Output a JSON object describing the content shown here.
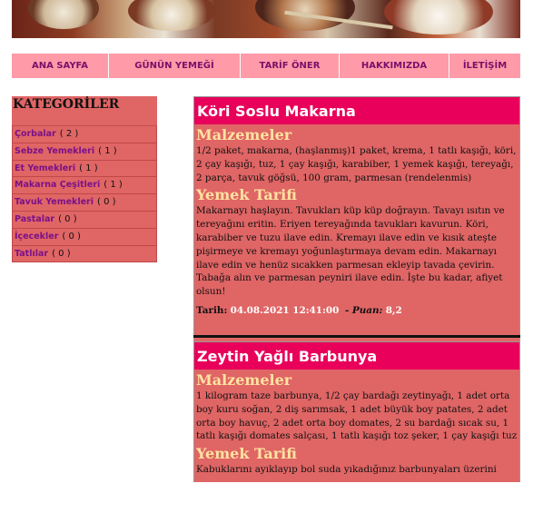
{
  "nav": {
    "items": [
      "ANA SAYFA",
      "GÜNÜN YEMEĞİ",
      "TARİF ÖNER",
      "HAKKIMIZDA",
      "İLETİŞİM"
    ]
  },
  "sidebar": {
    "title": "KATEGORİLER",
    "categories": [
      {
        "label": "Çorbalar",
        "count": "( 2 )"
      },
      {
        "label": "Sebze Yemekleri",
        "count": "( 1 )"
      },
      {
        "label": "Et Yemekleri",
        "count": "( 1 )"
      },
      {
        "label": "Makarna Çeşitleri",
        "count": "( 1 )"
      },
      {
        "label": "Tavuk Yemekleri",
        "count": "( 0 )"
      },
      {
        "label": "Pastalar",
        "count": "( 0 )"
      },
      {
        "label": "İçecekler",
        "count": "( 0 )"
      },
      {
        "label": "Tatlılar",
        "count": "( 0 )"
      }
    ]
  },
  "posts": [
    {
      "title": "Köri Soslu Makarna",
      "ingredients_heading": "Malzemeler",
      "ingredients": "1/2 paket, makarna, (haşlanmış)1 paket, krema, 1 tatlı kaşığı, köri, 2 çay kaşığı, tuz, 1 çay kaşığı, karabiber, 1 yemek kaşığı, tereyağı, 2 parça, tavuk göğsü, 100 gram, parmesan (rendelenmis)",
      "recipe_heading": "Yemek Tarifi",
      "recipe": "Makarnayı haşlayın. Tavukları küp küp doğrayın. Tavayı ısıtın ve tereyağını eritin. Eriyen tereyağında tavukları kavurun. Köri, karabiber ve tuzu ilave edin. Kremayı ilave edin ve kısık ateşte pişirmeye ve kremayı yoğunlaştırmaya devam edin. Makarnayı ilave edin ve henüz sıcakken parmesan ekleyip tavada çevirin. Tabağa alın ve parmesan peyniri ilave edin. İşte bu kadar, afiyet olsun!",
      "date_label": "Tarih:",
      "date": "04.08.2021 12:41:00",
      "score_label": "- Puan:",
      "score": "8,2"
    },
    {
      "title": "Zeytin Yağlı Barbunya",
      "ingredients_heading": "Malzemeler",
      "ingredients": "1 kilogram taze barbunya, 1/2 çay bardağı zeytinyağı, 1 adet orta boy kuru soğan, 2 diş sarımsak, 1 adet büyük boy patates, 2 adet orta boy havuç, 2 adet orta boy domates, 2 su bardağı sıcak su, 1 tatlı kaşığı domates salçası, 1 tatlı kaşığı toz şeker, 1 çay kaşığı tuz",
      "recipe_heading": "Yemek Tarifi",
      "recipe": "Kabuklarını ayıklayıp bol suda yıkadığınız barbunyaları üzerini"
    }
  ]
}
